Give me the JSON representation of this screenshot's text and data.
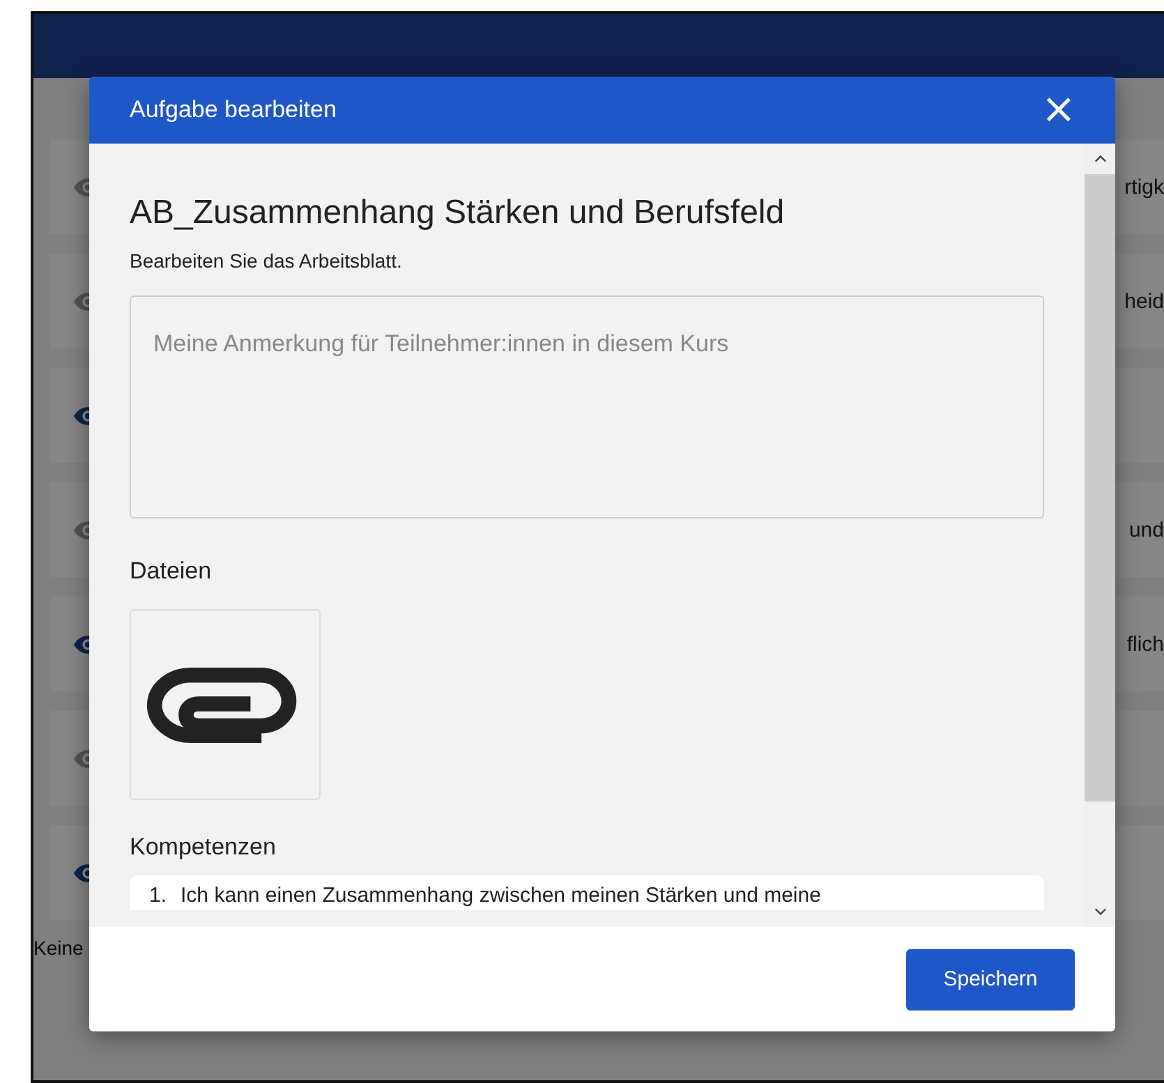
{
  "background": {
    "rows": [
      {
        "visible": false,
        "text": "rtigk"
      },
      {
        "visible": false,
        "text": "heid"
      },
      {
        "visible": true
      },
      {
        "visible": false,
        "text": "und"
      },
      {
        "visible": true,
        "text": "flich"
      },
      {
        "visible": false
      },
      {
        "visible": true
      }
    ],
    "footer_text": "Keine"
  },
  "dialog": {
    "title": "Aufgabe bearbeiten",
    "close": "×",
    "heading": "AB_Zusammenhang Stärken und Berufsfeld",
    "instruction": "Bearbeiten Sie das Arbeitsblatt.",
    "note_field": {
      "placeholder": "Meine Anmerkung für Teilnehmer:innen in diesem Kurs"
    },
    "files_label": "Dateien",
    "competences_label": "Kompetenzen",
    "competences": [
      {
        "number": "1.",
        "text": "Ich kann einen Zusammenhang zwischen meinen Stärken und meine"
      }
    ],
    "save_button": "Speichern"
  }
}
